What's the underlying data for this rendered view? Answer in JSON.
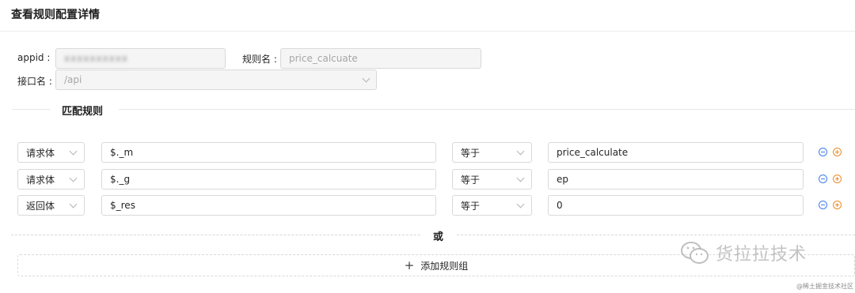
{
  "page": {
    "title": "查看规则配置详情"
  },
  "form": {
    "appid_label": "appid :",
    "appid_value": "xxxxxxxxxx",
    "rule_name_label": "规则名 :",
    "rule_name_value": "price_calcuate",
    "api_label": "接口名 :",
    "api_value": "/api"
  },
  "section": {
    "title": "匹配规则"
  },
  "rules": [
    {
      "source": "请求体",
      "path": "$._m",
      "operator": "等于",
      "value": "price_calculate"
    },
    {
      "source": "请求体",
      "path": "$._g",
      "operator": "等于",
      "value": "ep"
    },
    {
      "source": "返回体",
      "path": "$_res",
      "operator": "等于",
      "value": "0"
    }
  ],
  "divider": {
    "or_label": "或"
  },
  "add_group": {
    "icon": "plus-icon",
    "label": "添加规则组"
  },
  "watermark": {
    "text": "货拉拉技术",
    "footer": "@稀土掘金技术社区"
  },
  "colors": {
    "remove": "#3d7ee8",
    "add": "#f08a24"
  }
}
